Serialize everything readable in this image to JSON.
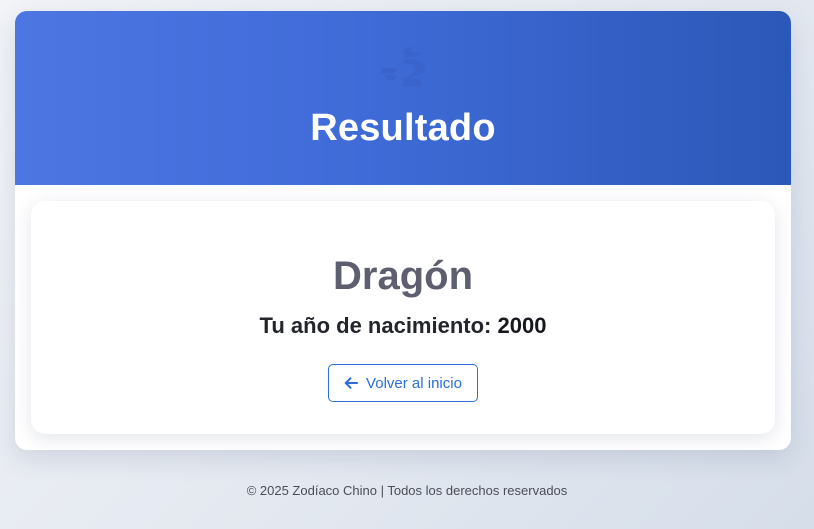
{
  "header": {
    "icon": "dragon-icon",
    "title": "Resultado"
  },
  "result": {
    "sign": "Dragón",
    "birth_label": "Tu año de nacimiento:",
    "birth_year": "2000"
  },
  "actions": {
    "back_icon": "arrow-left-icon",
    "back_label": "Volver al inicio"
  },
  "footer": {
    "text": "© 2025 Zodíaco Chino | Todos los derechos reservados"
  },
  "colors": {
    "header_gradient_start": "#4d76e2",
    "header_gradient_end": "#2c58b8",
    "accent": "#2a6ed6",
    "sign_text": "#5d5f6e"
  }
}
